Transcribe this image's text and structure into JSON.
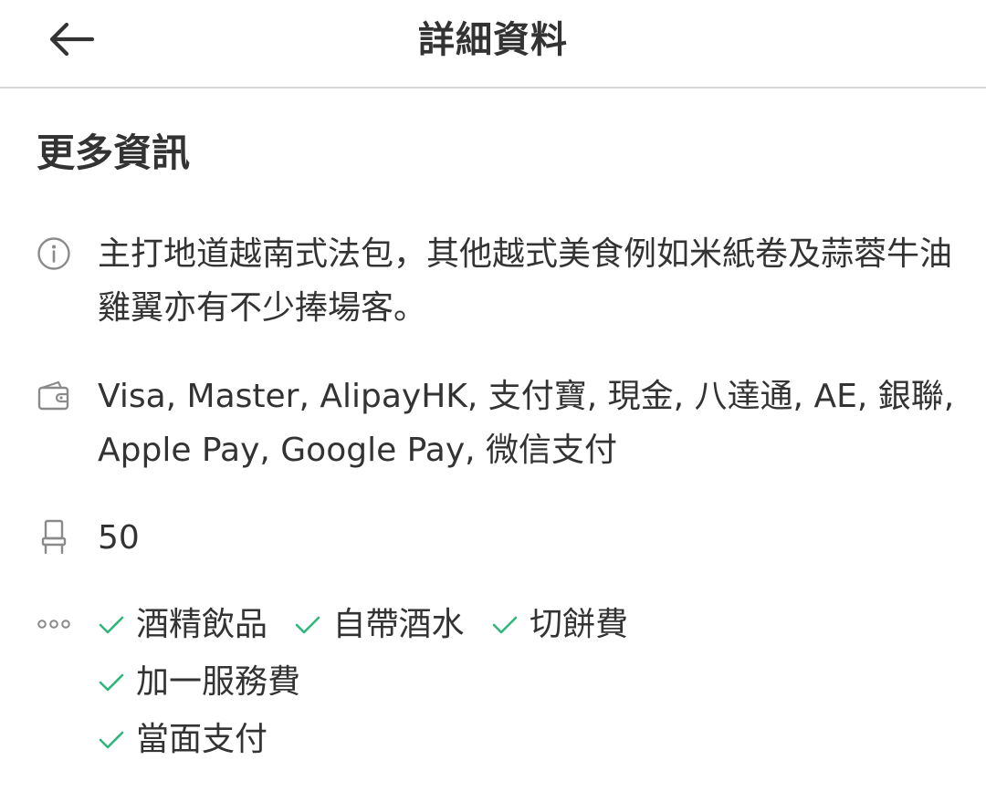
{
  "header": {
    "title": "詳細資料",
    "back_icon": "arrow-left-icon"
  },
  "section": {
    "title": "更多資訊"
  },
  "info": {
    "icon": "info-circle-icon",
    "text": "主打地道越南式法包，其他越式美食例如米紙卷及蒜蓉牛油雞翼亦有不少捧場客。"
  },
  "payment": {
    "icon": "wallet-icon",
    "text": "Visa, Master, AlipayHK, 支付寶, 現金, 八達通, AE, 銀聯, Apple Pay, Google Pay, 微信支付"
  },
  "seats": {
    "icon": "chair-icon",
    "value": "50"
  },
  "facilities": {
    "icon": "more-dots-icon",
    "check_icon": "check-icon",
    "check_color": "#2fb67c",
    "items": [
      "酒精飲品",
      "自帶酒水",
      "切餅費",
      "加一服務費",
      "當面支付"
    ]
  },
  "colors": {
    "text": "#333333",
    "icon": "#8a8a8a",
    "divider": "#d6d6d6",
    "check": "#2fb67c"
  }
}
